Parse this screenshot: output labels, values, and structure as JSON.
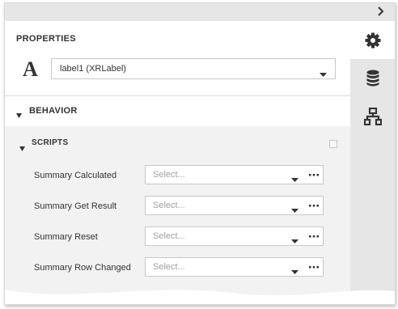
{
  "panel": {
    "title": "PROPERTIES",
    "type_glyph": "A",
    "selected_control": "label1 (XRLabel)"
  },
  "tabs": [
    {
      "icon": "gear-icon",
      "active": true
    },
    {
      "icon": "database-icon",
      "active": false
    },
    {
      "icon": "hierarchy-icon",
      "active": false
    }
  ],
  "behavior": {
    "label": "BEHAVIOR"
  },
  "scripts": {
    "label": "SCRIPTS",
    "rows": [
      {
        "label": "Summary Calculated",
        "placeholder": "Select..."
      },
      {
        "label": "Summary Get Result",
        "placeholder": "Select..."
      },
      {
        "label": "Summary Reset",
        "placeholder": "Select..."
      },
      {
        "label": "Summary Row Changed",
        "placeholder": "Select..."
      }
    ]
  },
  "colors": {
    "accent": "#333333",
    "rail_background": "#e6e6e6",
    "section_background": "#f2f2f2",
    "border": "#c8c8c8",
    "placeholder": "#a0a0a0"
  }
}
